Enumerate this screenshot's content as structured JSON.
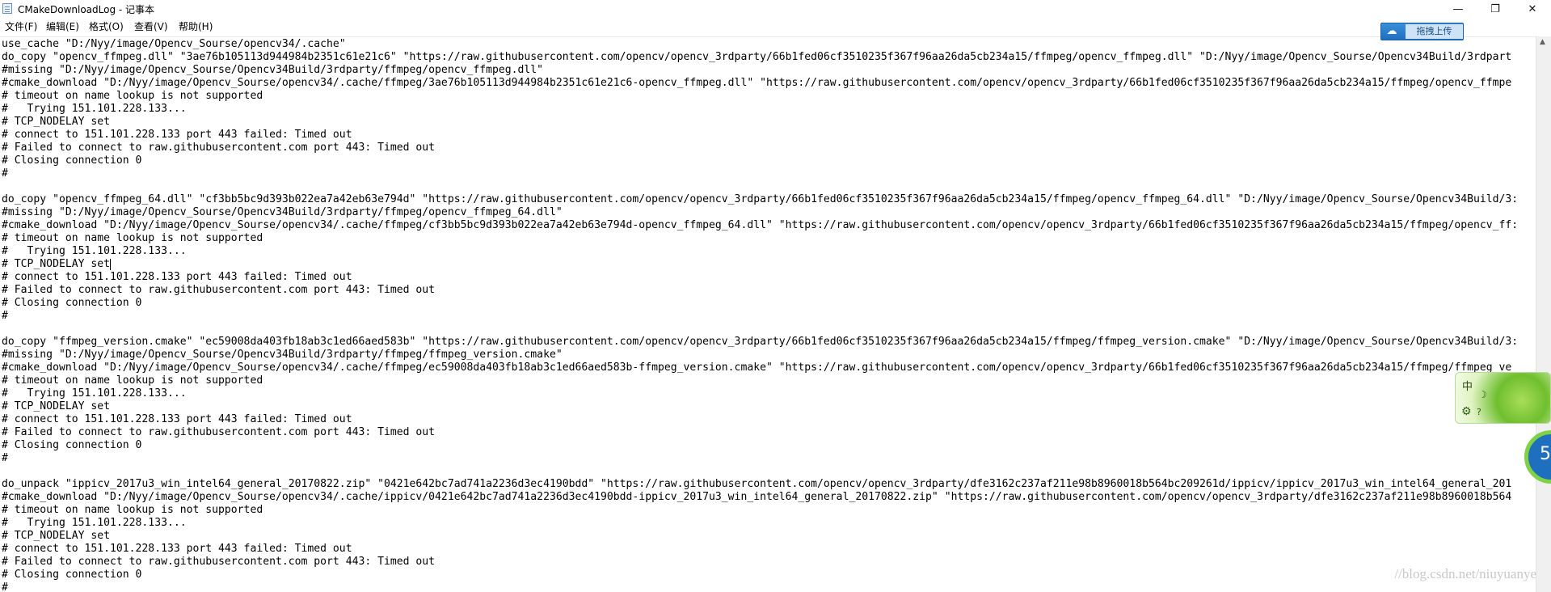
{
  "window": {
    "title": "CMakeDownloadLog - 记事本",
    "app_icon": "notepad-icon",
    "controls": {
      "minimize": "—",
      "maximize": "❐",
      "close": "✕"
    }
  },
  "menu": {
    "items": [
      "文件(F)",
      "编辑(E)",
      "格式(O)",
      "查看(V)",
      "帮助(H)"
    ]
  },
  "overlays": {
    "upload_button_label": "拖拽上传",
    "upload_icon": "cloud-icon",
    "ime_language": "中",
    "ime_moon_glyph": "☽",
    "ime_help_glyph": "?",
    "ime_settings_glyph": "⚙",
    "badge_number": "5",
    "watermark": "//blog.csdn.net/niuyuanye"
  },
  "editor": {
    "lines": [
      "use_cache \"D:/Nyy/image/Opencv_Sourse/opencv34/.cache\"",
      "do_copy \"opencv_ffmpeg.dll\" \"3ae76b105113d944984b2351c61e21c6\" \"https://raw.githubusercontent.com/opencv/opencv_3rdparty/66b1fed06cf3510235f367f96aa26da5cb234a15/ffmpeg/opencv_ffmpeg.dll\" \"D:/Nyy/image/Opencv_Sourse/Opencv34Build/3rdpart",
      "#missing \"D:/Nyy/image/Opencv_Sourse/Opencv34Build/3rdparty/ffmpeg/opencv_ffmpeg.dll\"",
      "#cmake_download \"D:/Nyy/image/Opencv_Sourse/opencv34/.cache/ffmpeg/3ae76b105113d944984b2351c61e21c6-opencv_ffmpeg.dll\" \"https://raw.githubusercontent.com/opencv/opencv_3rdparty/66b1fed06cf3510235f367f96aa26da5cb234a15/ffmpeg/opencv_ffmpe",
      "# timeout on name lookup is not supported",
      "#   Trying 151.101.228.133...",
      "# TCP_NODELAY set",
      "# connect to 151.101.228.133 port 443 failed: Timed out",
      "# Failed to connect to raw.githubusercontent.com port 443: Timed out",
      "# Closing connection 0",
      "#",
      "",
      "do_copy \"opencv_ffmpeg_64.dll\" \"cf3bb5bc9d393b022ea7a42eb63e794d\" \"https://raw.githubusercontent.com/opencv/opencv_3rdparty/66b1fed06cf3510235f367f96aa26da5cb234a15/ffmpeg/opencv_ffmpeg_64.dll\" \"D:/Nyy/image/Opencv_Sourse/Opencv34Build/3:",
      "#missing \"D:/Nyy/image/Opencv_Sourse/Opencv34Build/3rdparty/ffmpeg/opencv_ffmpeg_64.dll\"",
      "#cmake_download \"D:/Nyy/image/Opencv_Sourse/opencv34/.cache/ffmpeg/cf3bb5bc9d393b022ea7a42eb63e794d-opencv_ffmpeg_64.dll\" \"https://raw.githubusercontent.com/opencv/opencv_3rdparty/66b1fed06cf3510235f367f96aa26da5cb234a15/ffmpeg/opencv_ff:",
      "# timeout on name lookup is not supported",
      "#   Trying 151.101.228.133...",
      "# TCP_NODELAY set",
      "# connect to 151.101.228.133 port 443 failed: Timed out",
      "# Failed to connect to raw.githubusercontent.com port 443: Timed out",
      "# Closing connection 0",
      "#",
      "",
      "do_copy \"ffmpeg_version.cmake\" \"ec59008da403fb18ab3c1ed66aed583b\" \"https://raw.githubusercontent.com/opencv/opencv_3rdparty/66b1fed06cf3510235f367f96aa26da5cb234a15/ffmpeg/ffmpeg_version.cmake\" \"D:/Nyy/image/Opencv_Sourse/Opencv34Build/3:",
      "#missing \"D:/Nyy/image/Opencv_Sourse/Opencv34Build/3rdparty/ffmpeg/ffmpeg_version.cmake\"",
      "#cmake_download \"D:/Nyy/image/Opencv_Sourse/opencv34/.cache/ffmpeg/ec59008da403fb18ab3c1ed66aed583b-ffmpeg_version.cmake\" \"https://raw.githubusercontent.com/opencv/opencv_3rdparty/66b1fed06cf3510235f367f96aa26da5cb234a15/ffmpeg/ffmpeg_ve",
      "# timeout on name lookup is not supported",
      "#   Trying 151.101.228.133...",
      "# TCP_NODELAY set",
      "# connect to 151.101.228.133 port 443 failed: Timed out",
      "# Failed to connect to raw.githubusercontent.com port 443: Timed out",
      "# Closing connection 0",
      "#",
      "",
      "do_unpack \"ippicv_2017u3_win_intel64_general_20170822.zip\" \"0421e642bc7ad741a2236d3ec4190bdd\" \"https://raw.githubusercontent.com/opencv/opencv_3rdparty/dfe3162c237af211e98b8960018b564bc209261d/ippicv/ippicv_2017u3_win_intel64_general_201",
      "#cmake_download \"D:/Nyy/image/Opencv_Sourse/opencv34/.cache/ippicv/0421e642bc7ad741a2236d3ec4190bdd-ippicv_2017u3_win_intel64_general_20170822.zip\" \"https://raw.githubusercontent.com/opencv/opencv_3rdparty/dfe3162c237af211e98b8960018b564",
      "# timeout on name lookup is not supported",
      "#   Trying 151.101.228.133...",
      "# TCP_NODELAY set",
      "# connect to 151.101.228.133 port 443 failed: Timed out",
      "# Failed to connect to raw.githubusercontent.com port 443: Timed out",
      "# Closing connection 0",
      "#"
    ]
  }
}
